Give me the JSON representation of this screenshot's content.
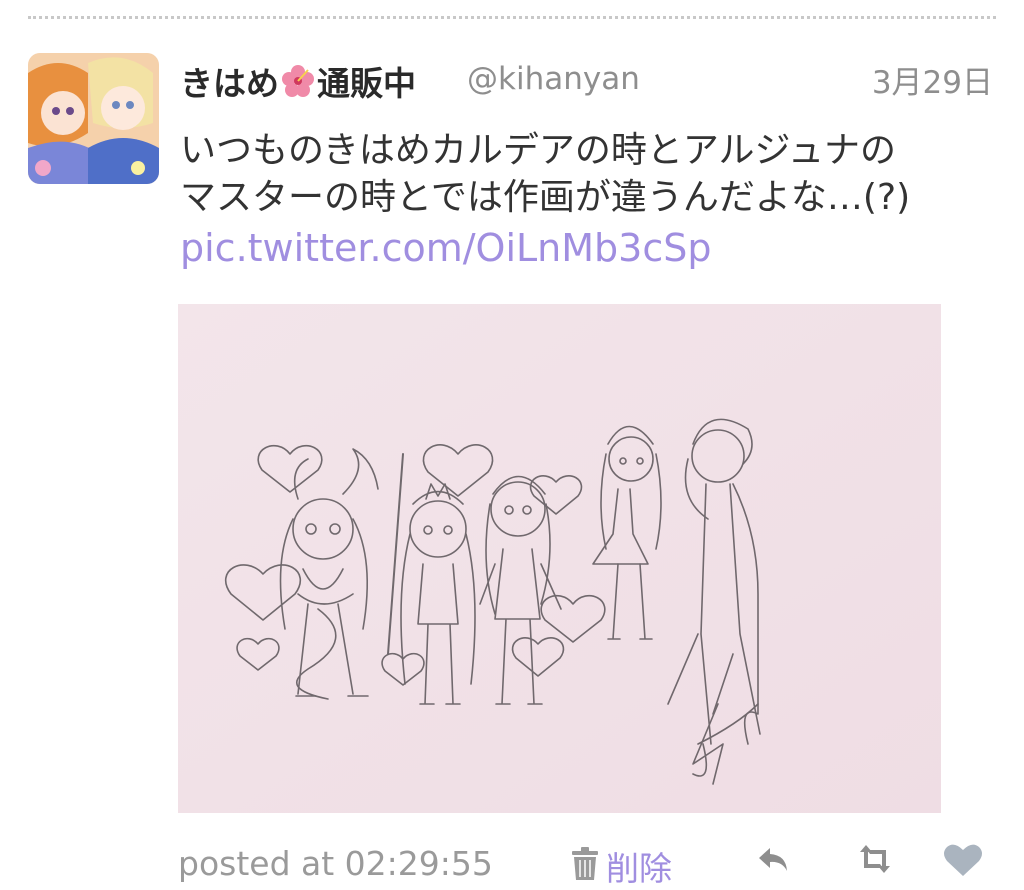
{
  "tweet": {
    "display_name_part1": "きはめ",
    "display_name_part2": "通販中",
    "handle": "@kihanyan",
    "date": "3月29日",
    "text": "いつものきはめカルデアの時とアルジュナの\nマスターの時とでは作画が違うんだよな…(?)",
    "link": "pic.twitter.com/OiLnMb3cSp"
  },
  "footer": {
    "posted_at": "posted at 02:29:55",
    "delete_label": "削除"
  },
  "icons": {
    "name_emoji": "hibiscus-icon",
    "trash": "trash-icon",
    "reply": "reply-icon",
    "retweet": "retweet-icon",
    "like": "heart-icon"
  },
  "colors": {
    "link": "#a08ee0",
    "muted": "#8e8e8e",
    "photo_bg": "#f2e3e8"
  }
}
